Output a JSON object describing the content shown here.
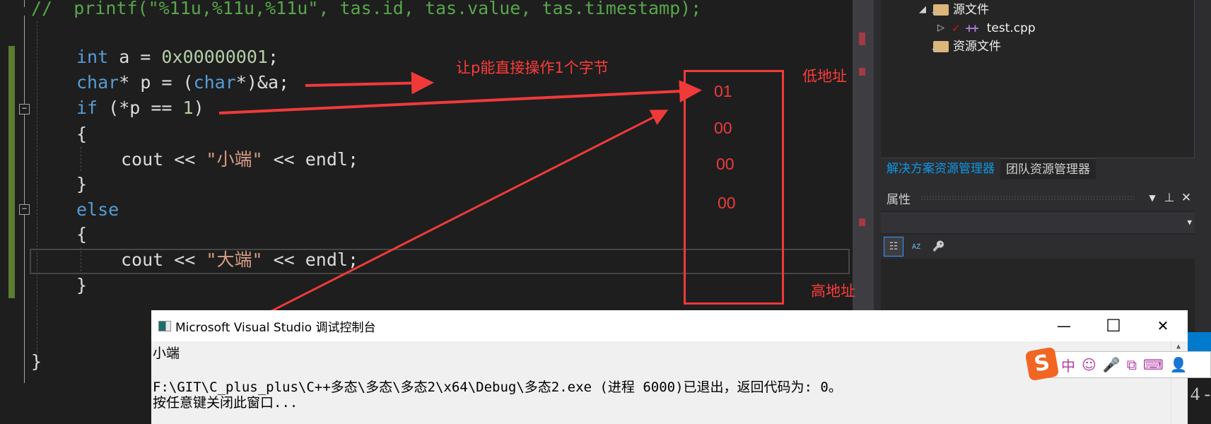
{
  "editor": {
    "lines": {
      "comment": "//  printf(\"%11u,%11u,%11u\", tas.id, tas.value, tas.timestamp);",
      "int_kw": "int",
      "int_rest_a": " a = ",
      "int_val": "0x00000001",
      "int_end": ";",
      "char_kw": "char",
      "char_mid": "* p = (",
      "char_kw2": "char",
      "char_end": "*)&a;",
      "if_kw": "if",
      "if_mid": " (*p == ",
      "if_num": "1",
      "if_end": ")",
      "brace_open": "{",
      "cout1_a": "cout << ",
      "cout1_str": "\"小端\"",
      "cout1_b": " << endl;",
      "brace_close": "}",
      "else_kw": "else",
      "cout2_a": "cout << ",
      "cout2_str": "\"大端\"",
      "cout2_b": " << endl;"
    },
    "fold_symbol": "−"
  },
  "solution_explorer": {
    "items": [
      {
        "label": "源文件",
        "expander": "◢"
      },
      {
        "label": "test.cpp",
        "expander": "▷",
        "status": "✓",
        "type_icon": "++"
      },
      {
        "label": "资源文件"
      }
    ],
    "tabs": [
      {
        "label": "解决方案资源管理器",
        "active": true
      },
      {
        "label": "团队资源管理器",
        "active": false
      }
    ]
  },
  "properties": {
    "title": "属性",
    "dropdown_icon": "▼",
    "pin_icon": "⊥",
    "close_icon": "✕",
    "combo_arrow": "▼",
    "toolbar": {
      "categorized": "☷",
      "alphabetical": "AZ",
      "property_pages": "🔑"
    }
  },
  "annotations": {
    "note": "让p能直接操作1个字节",
    "low_addr": "低地址",
    "high_addr": "高地址",
    "bytes": [
      "01",
      "00",
      "00",
      "00"
    ],
    "color": "#f03a3a"
  },
  "console": {
    "title": "Microsoft Visual Studio 调试控制台",
    "minimize": "—",
    "maximize": "☐",
    "close": "✕",
    "lines": [
      "小端",
      "",
      "F:\\GIT\\C_plus_plus\\C++多态\\多态\\多态2\\x64\\Debug\\多态2.exe (进程 6000)已退出，返回代码为: 0。",
      "按任意键关闭此窗口..."
    ]
  },
  "ime": {
    "logo": "S",
    "icons": [
      "中",
      "☺",
      "🎤",
      "⧉",
      "⌨",
      "👤"
    ]
  },
  "edge_text": "4 -"
}
